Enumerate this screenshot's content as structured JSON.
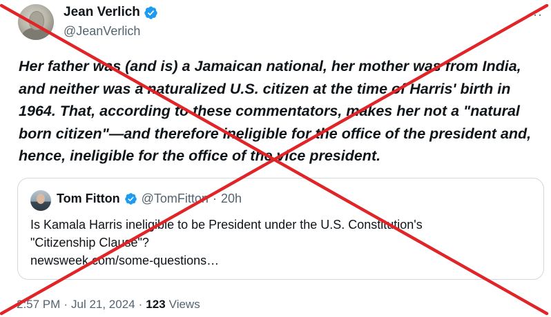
{
  "author": {
    "display_name": "Jean Verlich",
    "handle": "@JeanVerlich",
    "avatar_icon": "profile-photo",
    "verified_icon": "verified-badge-icon"
  },
  "more_options": "··",
  "tweet_text": "Her father was (and is) a Jamaican national, her mother was from India, and neither was a naturalized U.S. citizen at the time of Harris' birth in 1964. That, according to these commentators, makes her not a \"natural born citizen\"—and therefore ineligible for the office of the president and, hence, ineligible for the office of the vice president.",
  "quoted_tweet": {
    "display_name": "Tom Fitton",
    "handle": "@TomFitton",
    "separator": "·",
    "time": "20h",
    "text_line1": "Is Kamala Harris ineligible to be President under the U.S. Constitution's",
    "text_line2": "\"Citizenship Clause\"?",
    "link": "newsweek.com/some-questions…"
  },
  "meta": {
    "time": "2:57 PM",
    "dot1": "·",
    "date": "Jul 21, 2024",
    "dot2": "·",
    "views_count": "123",
    "views_label": "Views"
  },
  "colors": {
    "verified_blue": "#1d9bf0",
    "cross_red": "#e02428",
    "secondary_text": "#536471"
  }
}
